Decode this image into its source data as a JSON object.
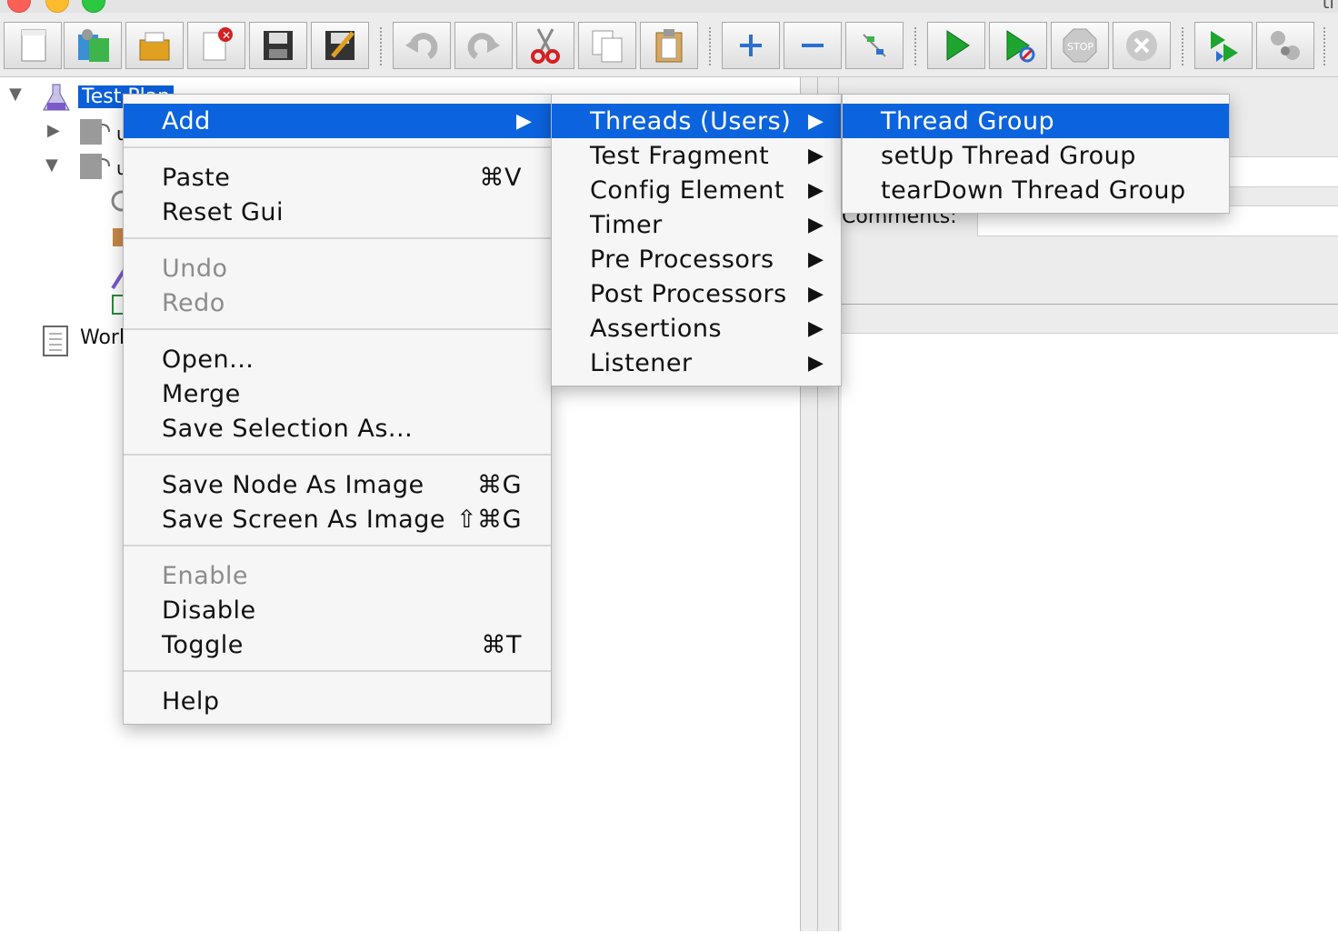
{
  "window": {
    "title_fragment": "tl"
  },
  "toolbar": {
    "buttons": [
      {
        "name": "new-icon"
      },
      {
        "name": "templates-icon"
      },
      {
        "name": "open-icon"
      },
      {
        "name": "close-icon"
      },
      {
        "name": "save-icon"
      },
      {
        "name": "save-as-icon"
      },
      {
        "name": "undo-icon"
      },
      {
        "name": "redo-icon"
      },
      {
        "name": "cut-icon"
      },
      {
        "name": "copy-icon"
      },
      {
        "name": "paste-icon"
      },
      {
        "name": "expand-icon"
      },
      {
        "name": "collapse-icon"
      },
      {
        "name": "toggle-icon"
      },
      {
        "name": "start-icon"
      },
      {
        "name": "start-no-pause-icon"
      },
      {
        "name": "stop-icon"
      },
      {
        "name": "shutdown-icon"
      },
      {
        "name": "remote-start-icon"
      },
      {
        "name": "remote-stop-icon"
      }
    ]
  },
  "tree": {
    "root_label": "Test Plan",
    "child1_label": "u",
    "child2_label": "u",
    "workbench_label": "Work"
  },
  "right_panel": {
    "comments_label": "Comments:"
  },
  "context_menu": {
    "add": "Add",
    "paste": "Paste",
    "paste_sc": "⌘V",
    "reset_gui": "Reset Gui",
    "undo": "Undo",
    "redo": "Redo",
    "open": "Open...",
    "merge": "Merge",
    "save_selection_as": "Save Selection As...",
    "save_node_as_image": "Save Node As Image",
    "save_node_sc": "⌘G",
    "save_screen_as_image": "Save Screen As Image",
    "save_screen_sc": "⇧⌘G",
    "enable": "Enable",
    "disable": "Disable",
    "toggle": "Toggle",
    "toggle_sc": "⌘T",
    "help": "Help"
  },
  "add_submenu": {
    "threads": "Threads (Users)",
    "test_fragment": "Test Fragment",
    "config_element": "Config Element",
    "timer": "Timer",
    "pre_processors": "Pre Processors",
    "post_processors": "Post Processors",
    "assertions": "Assertions",
    "listener": "Listener"
  },
  "threads_submenu": {
    "thread_group": "Thread Group",
    "setup_thread_group": "setUp Thread Group",
    "teardown_thread_group": "tearDown Thread Group"
  },
  "colors": {
    "highlight": "#0b63de",
    "disabled_text": "#8c8c8c"
  }
}
